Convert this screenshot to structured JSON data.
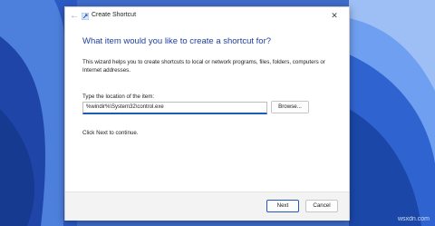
{
  "window": {
    "title": "Create Shortcut",
    "close_glyph": "✕",
    "back_glyph": "←"
  },
  "content": {
    "heading": "What item would you like to create a shortcut for?",
    "description": "This wizard helps you to create shortcuts to local or network programs, files, folders, computers or Internet addresses.",
    "location_label": "Type the location of the item:",
    "location_value": "%windir%\\System32\\control.exe",
    "browse_label": "Browse...",
    "next_hint": "Click Next to continue."
  },
  "footer": {
    "next_label": "Next",
    "cancel_label": "Cancel"
  },
  "watermark": "wsxdn.com",
  "colors": {
    "heading": "#1f3f9e",
    "accent": "#1e5bb8",
    "desktop": "#3f6ccc"
  }
}
